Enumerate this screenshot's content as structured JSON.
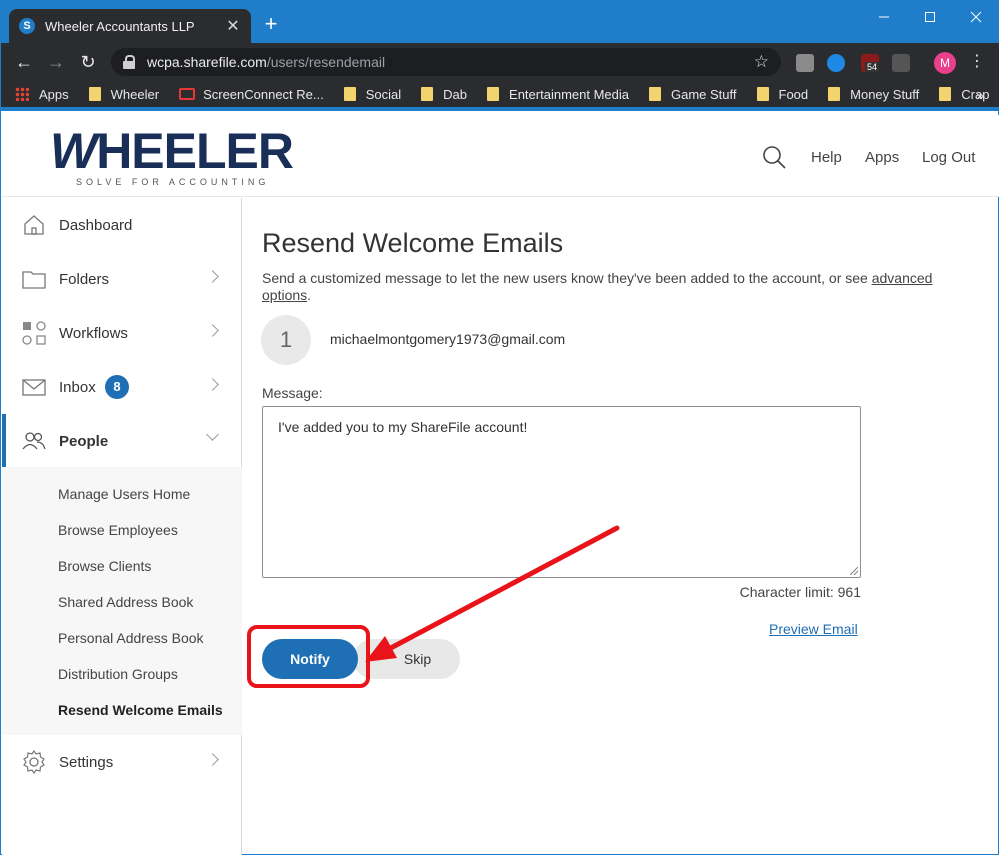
{
  "browser": {
    "tab_title": "Wheeler Accountants LLP",
    "favicon_letter": "S",
    "url_host": "wcpa.sharefile.com",
    "url_path": "/users/resendemail",
    "profile_initial": "M",
    "ext_badge": "54",
    "bookmarks": [
      "Apps",
      "Wheeler",
      "ScreenConnect Re...",
      "Social",
      "Dab",
      "Entertainment Media",
      "Game Stuff",
      "Food",
      "Money Stuff",
      "Crap"
    ]
  },
  "header": {
    "logo_word": "WHEELER",
    "logo_first": "W",
    "logo_rest": "HEELER",
    "logo_tagline": "SOLVE FOR ACCOUNTING",
    "links": {
      "help": "Help",
      "apps": "Apps",
      "logout": "Log Out"
    }
  },
  "sidebar": {
    "dashboard": "Dashboard",
    "folders": "Folders",
    "workflows": "Workflows",
    "inbox": "Inbox",
    "inbox_count": "8",
    "people": "People",
    "settings": "Settings",
    "people_sub": [
      "Manage Users Home",
      "Browse Employees",
      "Browse Clients",
      "Shared Address Book",
      "Personal Address Book",
      "Distribution Groups",
      "Resend Welcome Emails"
    ]
  },
  "main": {
    "title": "Resend Welcome Emails",
    "intro_text": "Send a customized message to let the new users know they've been added to the account, or see ",
    "intro_link": "advanced options",
    "intro_end": ".",
    "recipient_number": "1",
    "recipient_email": "michaelmontgomery1973@gmail.com",
    "message_label": "Message:",
    "message_value": "I've added you to my ShareFile account!",
    "char_limit": "Character limit: 961",
    "preview_link": "Preview Email",
    "notify_label": "Notify",
    "skip_label": "Skip"
  },
  "colors": {
    "accent": "#1f6fb5",
    "chrome_blue": "#1f7dc9",
    "annotation_red": "#e8141a",
    "logo_navy": "#1a2f57"
  }
}
